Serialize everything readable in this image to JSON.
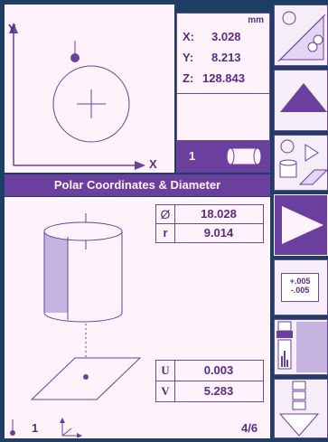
{
  "readout": {
    "unit": "mm",
    "x_label": "X:",
    "x_value": "3.028",
    "y_label": "Y:",
    "y_value": "8.213",
    "z_label": "Z:",
    "z_value": "128.843"
  },
  "axes": {
    "y_label": "Y",
    "x_label": "X"
  },
  "feature_count": "1",
  "mode_title": "Polar Coordinates & Diameter",
  "results": {
    "diameter_symbol": "Ø",
    "diameter_value": "18.028",
    "radius_label": "r",
    "radius_value": "9.014",
    "u_label": "U",
    "u_value": "0.003",
    "v_label": "V",
    "v_value": "5.283"
  },
  "footer": {
    "count": "1",
    "page": "4/6"
  },
  "tolerance": {
    "plus": "+.005",
    "minus": "-.005"
  },
  "colors": {
    "accent": "#6b3f9e",
    "background": "#1d3f66",
    "panel": "#fff3fb"
  }
}
